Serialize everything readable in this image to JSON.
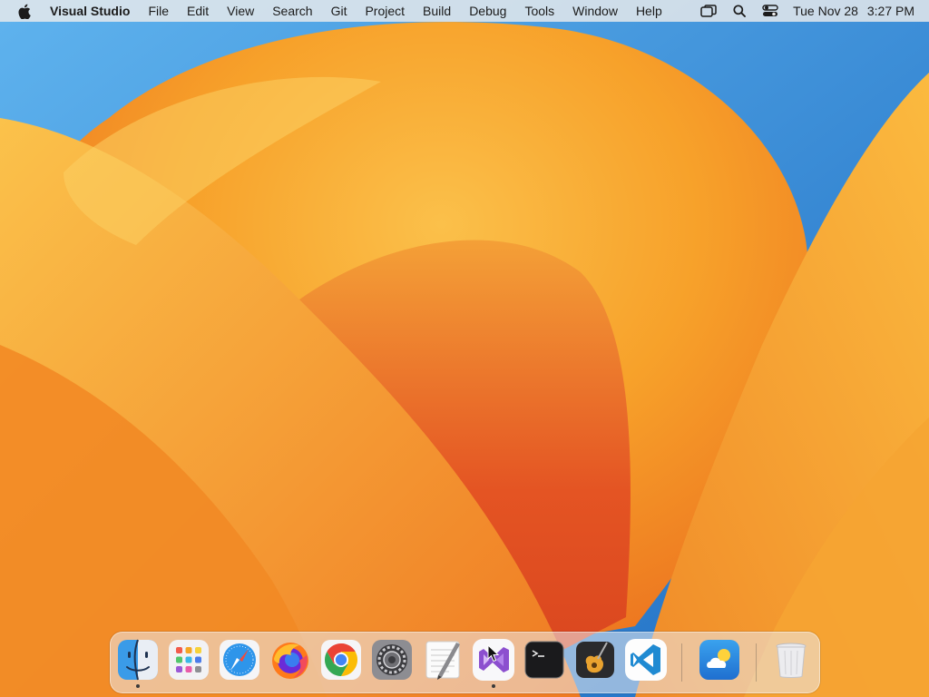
{
  "menubar": {
    "app_name": "Visual Studio",
    "menus": [
      "File",
      "Edit",
      "View",
      "Search",
      "Git",
      "Project",
      "Build",
      "Debug",
      "Tools",
      "Window",
      "Help"
    ],
    "status_icons": [
      "screen-mirroring-icon",
      "spotlight-search-icon",
      "control-center-icon"
    ],
    "clock": {
      "date": "Tue Nov 28",
      "time": "3:27 PM"
    }
  },
  "dock": {
    "apps": [
      {
        "name": "Finder",
        "icon": "finder-icon",
        "running": true
      },
      {
        "name": "Launchpad",
        "icon": "launchpad-icon",
        "running": false
      },
      {
        "name": "Safari",
        "icon": "safari-icon",
        "running": false
      },
      {
        "name": "Firefox",
        "icon": "firefox-icon",
        "running": false
      },
      {
        "name": "Google Chrome",
        "icon": "chrome-icon",
        "running": false
      },
      {
        "name": "System Settings",
        "icon": "system-settings-icon",
        "running": false
      },
      {
        "name": "TextEdit",
        "icon": "textedit-icon",
        "running": false
      },
      {
        "name": "Visual Studio",
        "icon": "visual-studio-icon",
        "running": true
      },
      {
        "name": "Terminal",
        "icon": "terminal-icon",
        "running": false
      },
      {
        "name": "GarageBand",
        "icon": "garageband-icon",
        "running": false
      },
      {
        "name": "Visual Studio Code",
        "icon": "vscode-icon",
        "running": false
      },
      {
        "name": "Weather",
        "icon": "weather-icon",
        "running": false
      },
      {
        "name": "Trash",
        "icon": "trash-icon",
        "running": false
      }
    ]
  },
  "colors": {
    "wallpaper_orange": "#f59a22",
    "wallpaper_blue": "#2f86d6",
    "accent_vs_purple": "#8c4fcf",
    "vscode_blue": "#1f8ad2"
  }
}
